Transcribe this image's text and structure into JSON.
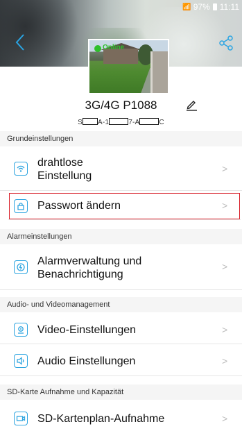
{
  "status_bar": {
    "signal": "▽▌",
    "battery_percent": "97%",
    "time": "11:11"
  },
  "thumbnail": {
    "online_label": "Online"
  },
  "device": {
    "name": "3G/4G P1088",
    "serial_parts": [
      "S",
      "A-1",
      "7-A",
      "C"
    ]
  },
  "sections": [
    {
      "title": "Grundeinstellungen",
      "items": [
        {
          "label_line1": "drahtlose",
          "label_line2": "Einstellung",
          "icon": "wifi-icon"
        },
        {
          "label": "Passwort ändern",
          "icon": "lock-icon"
        }
      ]
    },
    {
      "title": "Alarmeinstellungen",
      "items": [
        {
          "label_line1": "Alarmverwaltung und",
          "label_line2": "Benachrichtigung",
          "icon": "alarm-icon"
        }
      ]
    },
    {
      "title": "Audio- und Videomanagement",
      "items": [
        {
          "label": "Video-Einstellungen",
          "icon": "camera-icon"
        },
        {
          "label": "Audio Einstellungen",
          "icon": "speaker-icon"
        }
      ]
    },
    {
      "title": "SD-Karte Aufnahme und Kapazität",
      "items": [
        {
          "label": "SD-Kartenplan-Aufnahme",
          "icon": "video-record-icon"
        }
      ]
    }
  ],
  "accent_color": "#2fa5e0",
  "highlight_color": "#d9232d",
  "chevron": ">"
}
